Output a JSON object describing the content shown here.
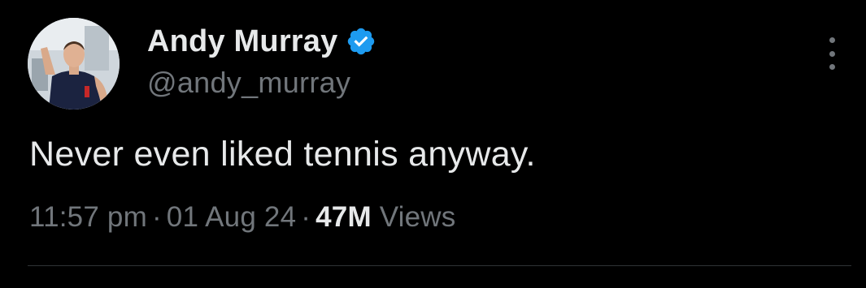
{
  "author": {
    "display_name": "Andy Murray",
    "handle": "@andy_murray",
    "verified": true,
    "avatar": "profile-photo-avatar"
  },
  "tweet": {
    "text": "Never even liked tennis anyway.",
    "time": "11:57 pm",
    "date": "01 Aug 24",
    "views_count": "47M",
    "views_label": "Views",
    "separator": "·"
  },
  "icons": {
    "verified": "verified-badge-icon",
    "more": "more-options-icon"
  },
  "colors": {
    "background": "#000000",
    "primary_text": "#e7e9ea",
    "secondary_text": "#71767b",
    "verified_blue": "#1d9bf0",
    "divider": "#2f3336"
  }
}
